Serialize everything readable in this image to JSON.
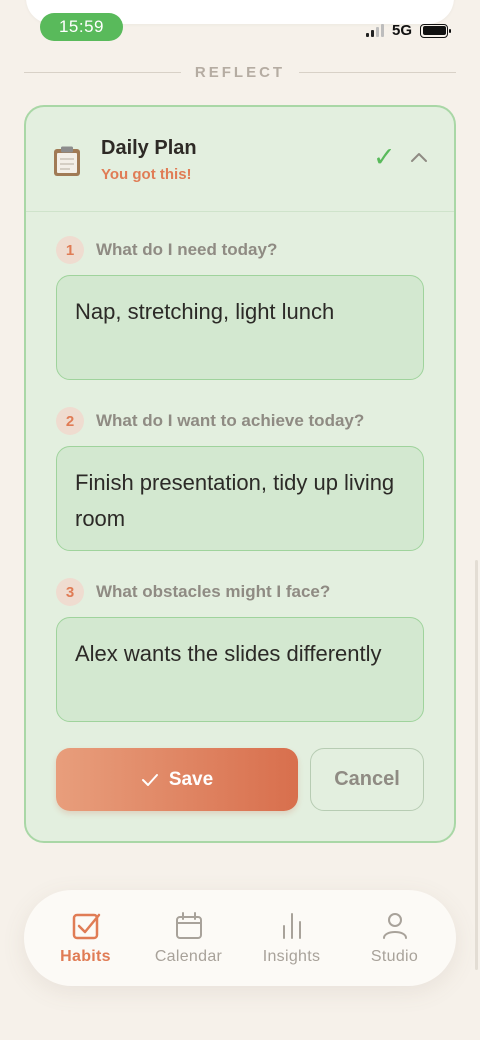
{
  "status_bar": {
    "time": "15:59",
    "network": "5G"
  },
  "section": {
    "title": "REFLECT"
  },
  "card": {
    "title": "Daily Plan",
    "subtitle": "You got this!",
    "icon": "clipboard-icon",
    "questions": [
      {
        "number": "1",
        "text": "What do I need today?",
        "answer": "Nap, stretching, light lunch"
      },
      {
        "number": "2",
        "text": "What do I want to achieve today?",
        "answer": "Finish presentation, tidy up living room"
      },
      {
        "number": "3",
        "text": "What obstacles might I face?",
        "answer": "Alex wants the slides differently"
      }
    ],
    "save_label": "Save",
    "cancel_label": "Cancel"
  },
  "nav": {
    "items": [
      {
        "label": "Habits",
        "icon": "checkbox-icon",
        "active": true
      },
      {
        "label": "Calendar",
        "icon": "calendar-icon",
        "active": false
      },
      {
        "label": "Insights",
        "icon": "bar-chart-icon",
        "active": false
      },
      {
        "label": "Studio",
        "icon": "person-icon",
        "active": false
      }
    ]
  },
  "colors": {
    "accent": "#e07c55",
    "success": "#59ba5b",
    "card_bg": "#e3efdf",
    "card_border": "#a9d7a6",
    "page_bg": "#f6f1ea"
  }
}
